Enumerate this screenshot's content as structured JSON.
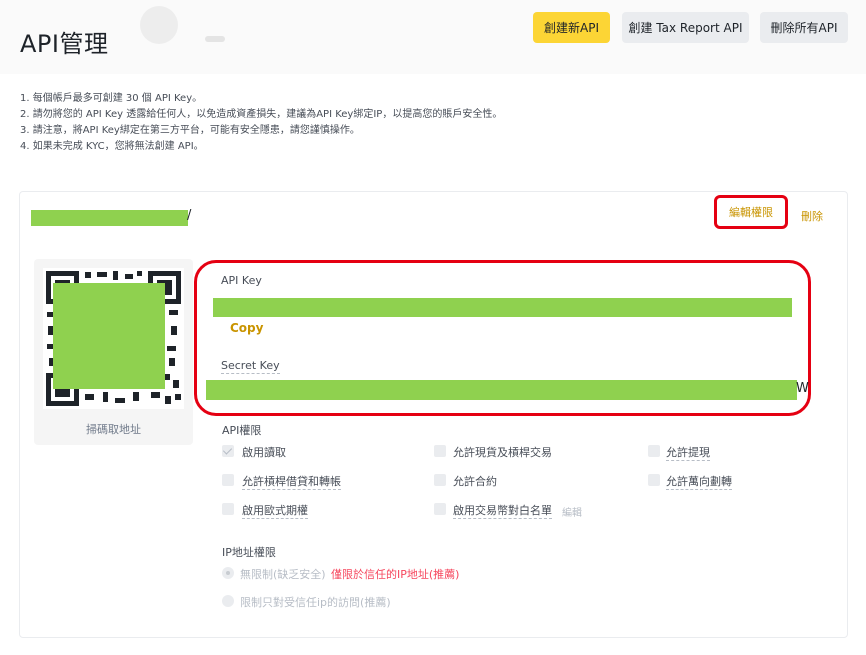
{
  "header": {
    "title": "API管理",
    "buttons": {
      "create_api": "創建新API",
      "create_tax_api": "創建 Tax Report API",
      "delete_all": "刪除所有API"
    }
  },
  "notes": [
    "1. 每個帳戶最多可創建 30 個 API Key。",
    "2. 請勿將您的 API Key 透露給任何人，以免造成資產損失，建議為API Key綁定IP，以提高您的賬戶安全性。",
    "3. 請注意，將API Key綁定在第三方平台，可能有安全隱患，請您謹慎操作。",
    "4. 如果未完成 KYC，您將無法創建 API。"
  ],
  "card": {
    "label_tail": "/",
    "edit_permissions": "編輯權限",
    "delete": "刪除",
    "qr_caption": "掃碼取地址",
    "api_key_title": "API Key",
    "copy": "Copy",
    "secret_key_title": "Secret Key",
    "secret_tail": "W",
    "permissions": {
      "title": "API權限",
      "items": [
        {
          "label": "啟用讀取",
          "checked": true
        },
        {
          "label": "允許現貨及槓桿交易",
          "checked": false
        },
        {
          "label": "允許提現",
          "checked": false
        },
        {
          "label": "允許槓桿借貸和轉帳",
          "checked": false
        },
        {
          "label": "允許合約",
          "checked": false
        },
        {
          "label": "允許萬向劃轉",
          "checked": false
        },
        {
          "label": "啟用歐式期權",
          "checked": false
        },
        {
          "label": "啟用交易幣對白名單",
          "checked": false
        }
      ],
      "edit": "編輯"
    },
    "ip": {
      "title": "IP地址權限",
      "unrestricted": "無限制(缺乏安全)",
      "warning": "僅限於信任的IP地址(推薦)",
      "restricted": "限制只對受信任ip的訪問(推薦)"
    }
  },
  "colors": {
    "accent_yellow": "#fcd535",
    "link_gold": "#c99400",
    "annotation_red": "#e50012",
    "redaction_green": "#8fd14f",
    "warning_red": "#f6465d"
  }
}
